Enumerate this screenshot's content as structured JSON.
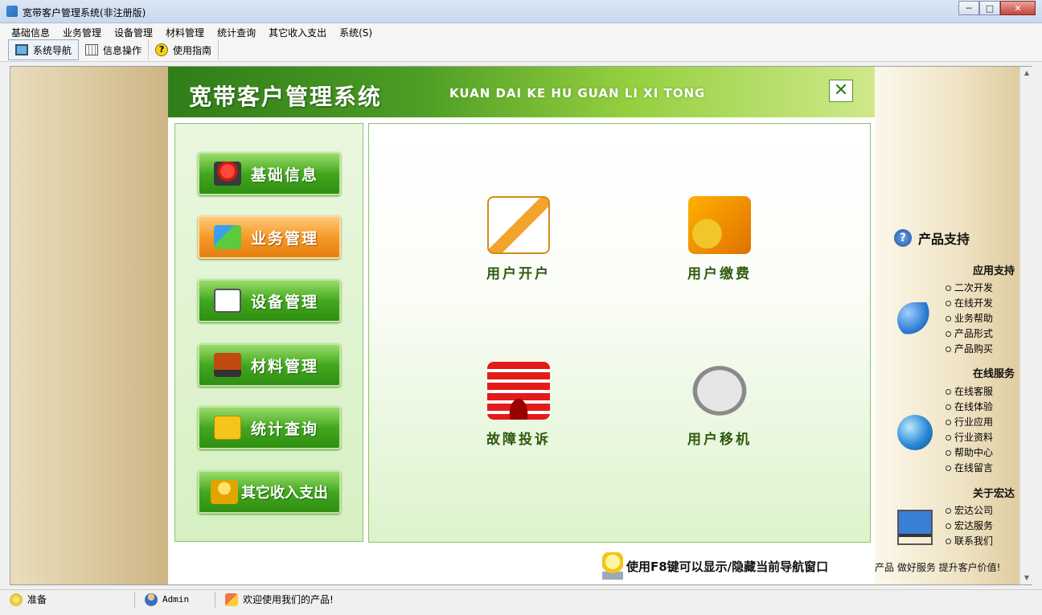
{
  "window": {
    "title": "宽带客户管理系统(非注册版)",
    "minimize": "─",
    "maximize": "□",
    "close": "✕"
  },
  "menu": [
    "基础信息",
    "业务管理",
    "设备管理",
    "材料管理",
    "统计查询",
    "其它收入支出",
    "系统(S)"
  ],
  "toolbar": {
    "items": [
      "系统导航",
      "信息操作",
      "使用指南"
    ],
    "active": "系统导航"
  },
  "nav": {
    "title": "宽带客户管理系统",
    "subtitle": "KUAN DAI KE HU GUAN LI XI TONG",
    "close_label": "✕",
    "buttons": [
      "基础信息",
      "业务管理",
      "设备管理",
      "材料管理",
      "统计查询",
      "其它收入支出"
    ],
    "active_button": "业务管理",
    "features": [
      "用户开户",
      "用户缴费",
      "故障投诉",
      "用户移机"
    ],
    "f8_tip": "使用F8键可以显示/隐藏当前导航窗口"
  },
  "support": {
    "heading": "产品支持",
    "q_icon": "?",
    "sections": [
      {
        "title": "应用支持",
        "links": [
          "二次开发",
          "在线开发",
          "业务帮助",
          "产品形式",
          "产品购买"
        ]
      },
      {
        "title": "在线服务",
        "links": [
          "在线客服",
          "在线体验",
          "行业应用",
          "行业资料",
          "帮助中心",
          "在线留言"
        ]
      },
      {
        "title": "关于宏达",
        "links": [
          "宏达公司",
          "宏达服务",
          "联系我们"
        ]
      }
    ],
    "slogan": "产品 做好服务 提升客户价值!"
  },
  "scroll": {
    "up": "▲",
    "down": "▼"
  },
  "status": {
    "ready": "准备",
    "user": "Admin",
    "welcome": "欢迎使用我们的产品!"
  },
  "icons": {
    "app": "app-icon",
    "monitor": "monitor-icon",
    "grid": "grid-icon",
    "help": "help-icon",
    "bulb": "lightbulb-icon",
    "arrow": "arrow-icon",
    "globe": "globe-icon",
    "computer": "computer-icon"
  },
  "colors": {
    "header_green": "#2f7d18",
    "button_green": "#42a81e",
    "button_active_orange": "#f59a26",
    "label_green": "#2e5a10"
  }
}
